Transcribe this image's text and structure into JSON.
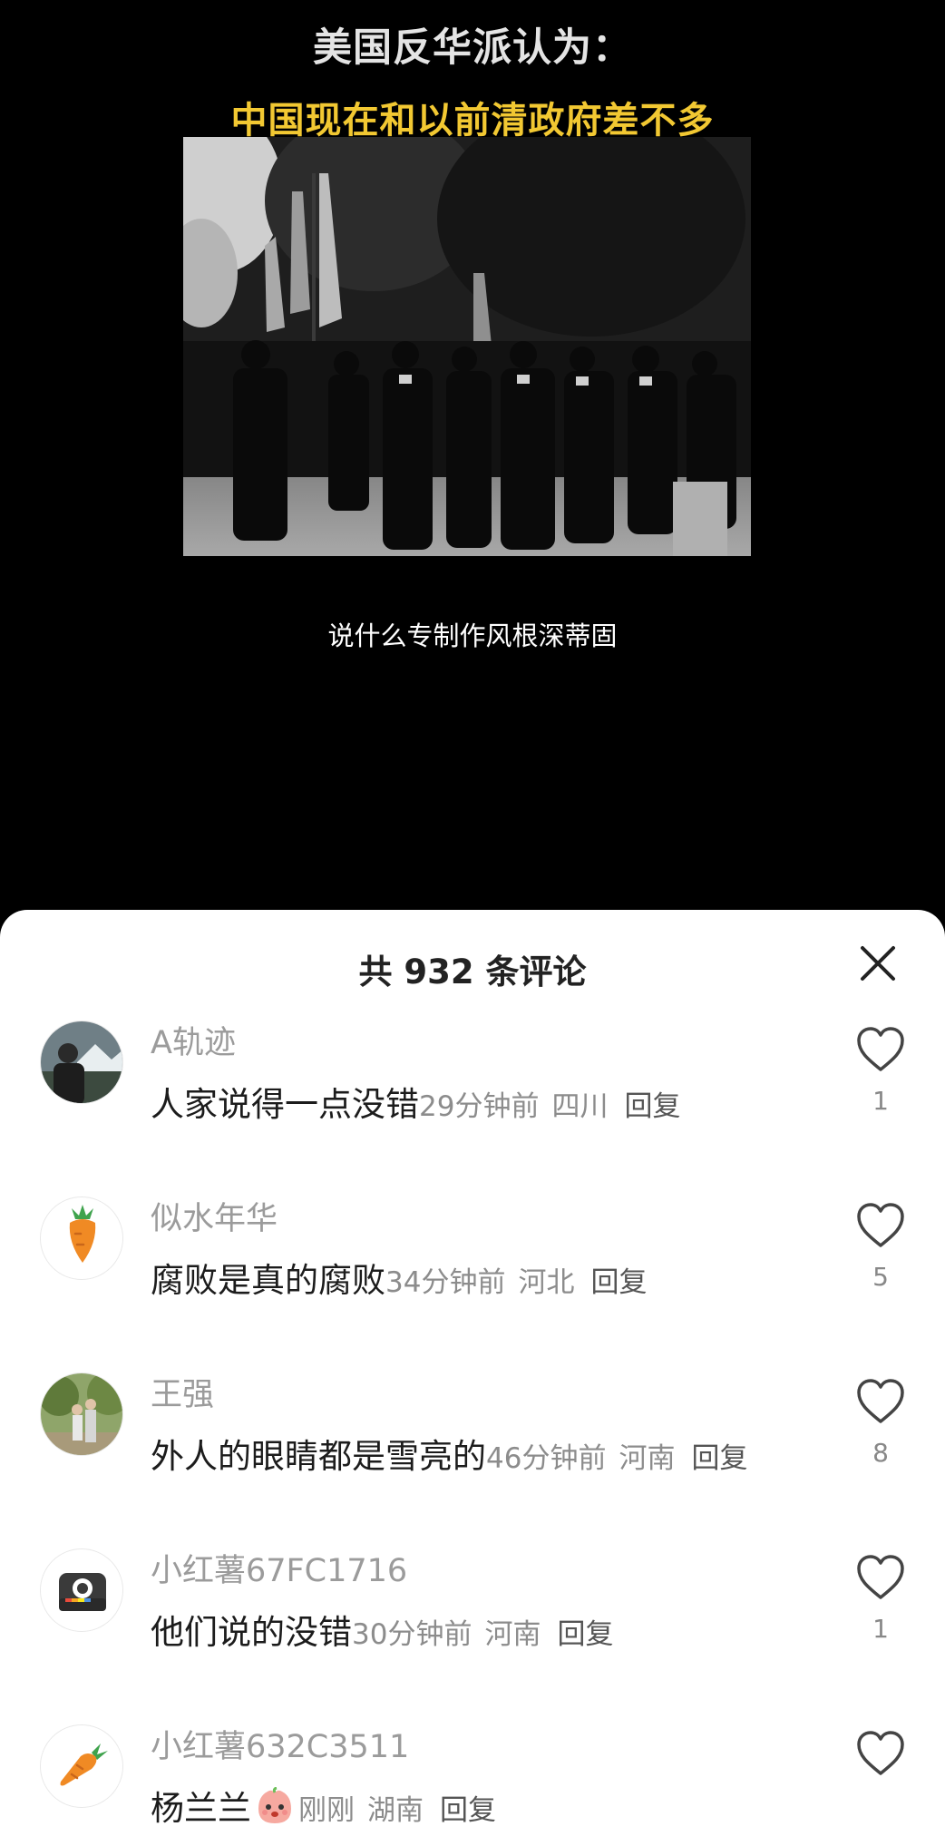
{
  "video": {
    "title": "美国反华派认为：",
    "subtitle": "中国现在和以前清政府差不多",
    "caption": "说什么专制作风根深蒂固"
  },
  "comments_panel": {
    "title": "共 932 条评论",
    "close_icon": "close-icon",
    "comments": [
      {
        "username": "A轨迹",
        "text": "人家说得一点没错",
        "time": "29分钟前",
        "region": "四川",
        "reply": "回复",
        "likes": "1",
        "avatar": "photo-avatar"
      },
      {
        "username": "似水年华",
        "text": "腐败是真的腐败",
        "time": "34分钟前",
        "region": "河北",
        "reply": "回复",
        "likes": "5",
        "avatar": "carrot-avatar"
      },
      {
        "username": "王强",
        "text": "外人的眼睛都是雪亮的",
        "time": "46分钟前",
        "region": "河南",
        "reply": "回复",
        "likes": "8",
        "avatar": "family-photo-avatar"
      },
      {
        "username": "小红薯67FC1716",
        "text": "他们说的没错",
        "time": "30分钟前",
        "region": "河南",
        "reply": "回复",
        "likes": "1",
        "avatar": "camera-avatar"
      },
      {
        "username": "小红薯632C3511",
        "text": "杨兰兰",
        "time": "刚刚",
        "region": "湖南",
        "reply": "回复",
        "likes": "",
        "avatar": "carrot-avatar",
        "emoji": "peach-face-emoji"
      }
    ]
  },
  "colors": {
    "background": "#000000",
    "subtitle_yellow": "#f2c832",
    "sheet": "#ffffff",
    "muted_text": "#9b9b9b"
  }
}
